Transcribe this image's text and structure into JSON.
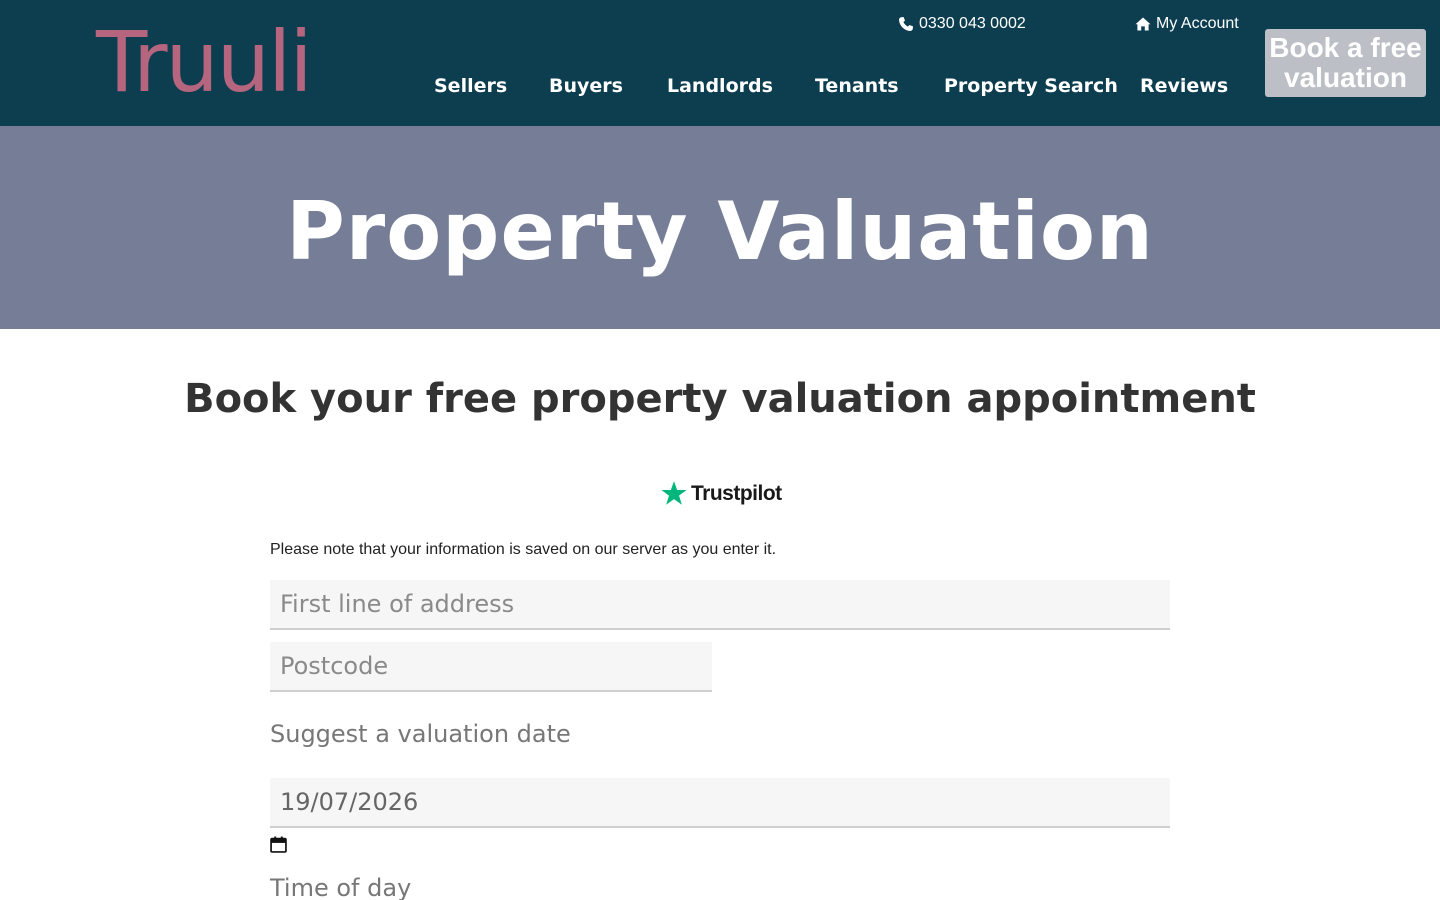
{
  "header": {
    "logo_text": "Truuli",
    "phone": "0330 043 0002",
    "account_label": "My Account",
    "nav": [
      {
        "label": "Sellers"
      },
      {
        "label": "Buyers"
      },
      {
        "label": "Landlords"
      },
      {
        "label": "Tenants"
      },
      {
        "label": "Property Search"
      },
      {
        "label": "Reviews"
      }
    ],
    "cta_label": "Book a free valuation",
    "icons": {
      "phone": "phone-icon",
      "account": "home-icon"
    }
  },
  "hero": {
    "title": "Property Valuation"
  },
  "main": {
    "section_title": "Book your free property valuation appointment",
    "trustpilot_label": "Trustpilot",
    "note": "Please note that your information is saved on our server as you enter it.",
    "form": {
      "address_placeholder": "First line of address",
      "postcode_placeholder": "Postcode",
      "date_label": "Suggest a valuation date",
      "date_value": "19/07/2026",
      "time_label": "Time of day"
    }
  },
  "colors": {
    "header_bg": "#0d3e50",
    "logo": "#b5657e",
    "hero_bg": "#757e96",
    "cta_bg": "#bcc0c6",
    "trustpilot_green": "#00b67a"
  }
}
